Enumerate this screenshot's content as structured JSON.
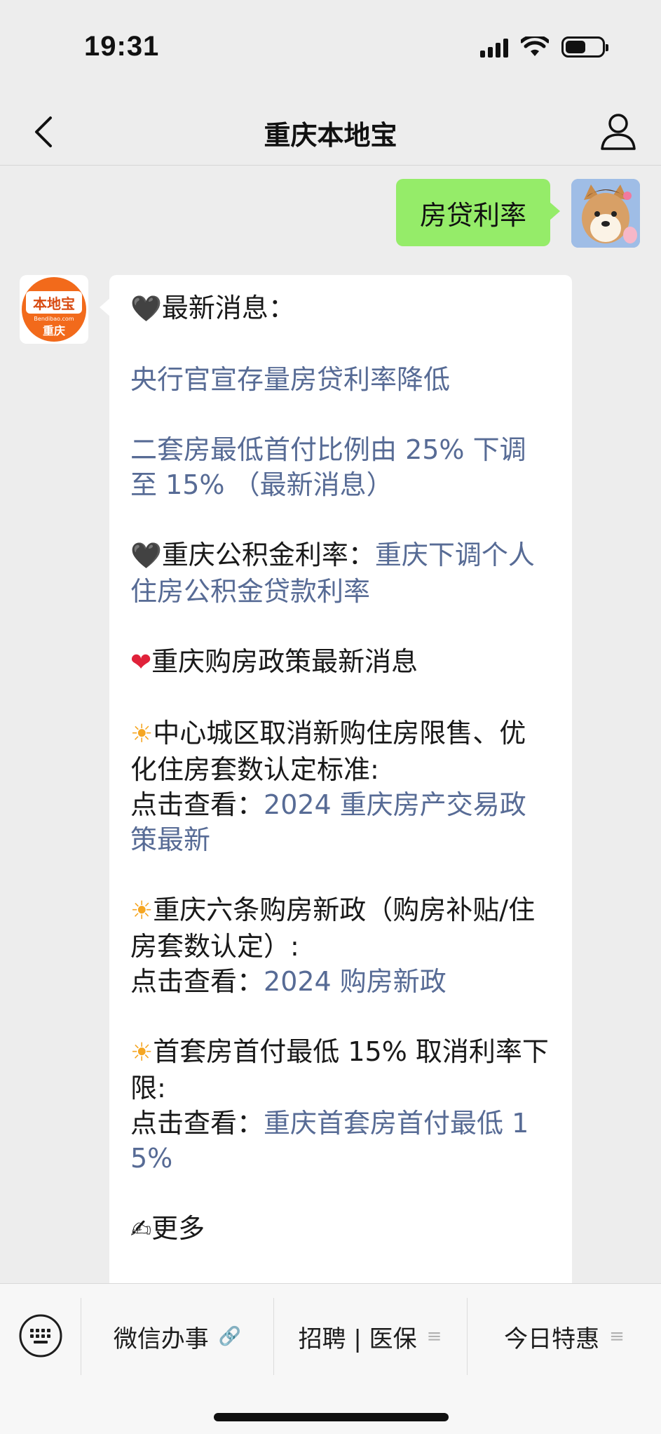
{
  "status_bar": {
    "time": "19:31"
  },
  "nav": {
    "title": "重庆本地宝"
  },
  "sent_message": {
    "text": "房贷利率"
  },
  "bot": {
    "logo_top": "本地宝",
    "logo_mid": "Bendibao.com",
    "logo_bottom": "重庆"
  },
  "message": {
    "p1_lead": "最新消息：",
    "p2_link": "央行官宣存量房贷利率降低",
    "p3_link": "二套房最低首付比例由 25% 下调至 15% （最新消息）",
    "p4_lead": "重庆公积金利率：",
    "p4_link": "重庆下调个人住房公积金贷款利率",
    "p5_text": "重庆购房政策最新消息",
    "p6_text": "中心城区取消新购住房限售、优化住房套数认定标准:",
    "p6_cta": "点击查看：",
    "p6_link": "2024 重庆房产交易政策最新",
    "p7_text": "重庆六条购房新政（购房补贴/住房套数认定）:",
    "p7_cta": "点击查看：",
    "p7_link": "2024 购房新政",
    "p8_text": "首套房首付最低 15% 取消利率下限:",
    "p8_cta": "点击查看：",
    "p8_link": "重庆首套房首付最低 15%",
    "p9_text": "更多"
  },
  "bottom_menu": {
    "item1": "微信办事",
    "item2": "招聘 | 医保",
    "item3": "今日特惠"
  },
  "colors": {
    "link": "#576b95",
    "sent_bubble": "#95ec69",
    "brand_orange": "#f26a1b"
  }
}
